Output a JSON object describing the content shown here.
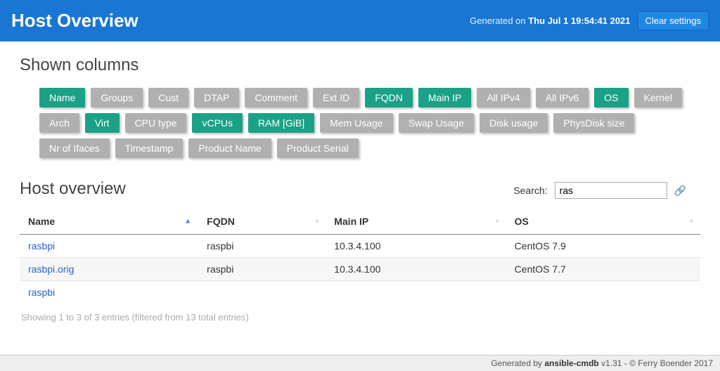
{
  "header": {
    "title": "Host Overview",
    "generated_prefix": "Generated on ",
    "generated_date": "Thu Jul 1 19:54:41 2021",
    "clear_label": "Clear settings"
  },
  "shown_columns": {
    "title": "Shown columns",
    "items": [
      {
        "label": "Name",
        "on": true
      },
      {
        "label": "Groups",
        "on": false
      },
      {
        "label": "Cust",
        "on": false
      },
      {
        "label": "DTAP",
        "on": false
      },
      {
        "label": "Comment",
        "on": false
      },
      {
        "label": "Ext ID",
        "on": false
      },
      {
        "label": "FQDN",
        "on": true
      },
      {
        "label": "Main IP",
        "on": true
      },
      {
        "label": "All IPv4",
        "on": false
      },
      {
        "label": "All IPv6",
        "on": false
      },
      {
        "label": "OS",
        "on": true
      },
      {
        "label": "Kernel",
        "on": false
      },
      {
        "label": "Arch",
        "on": false
      },
      {
        "label": "Virt",
        "on": true
      },
      {
        "label": "CPU type",
        "on": false
      },
      {
        "label": "vCPUs",
        "on": true
      },
      {
        "label": "RAM [GiB]",
        "on": true
      },
      {
        "label": "Mem Usage",
        "on": false
      },
      {
        "label": "Swap Usage",
        "on": false
      },
      {
        "label": "Disk usage",
        "on": false
      },
      {
        "label": "PhysDisk size",
        "on": false
      },
      {
        "label": "Nr of Ifaces",
        "on": false
      },
      {
        "label": "Timestamp",
        "on": false
      },
      {
        "label": "Product Name",
        "on": false
      },
      {
        "label": "Product Serial",
        "on": false
      }
    ]
  },
  "overview": {
    "title": "Host overview",
    "search_label": "Search:",
    "search_value": "ras",
    "headers": [
      "Name",
      "FQDN",
      "Main IP",
      "OS"
    ],
    "rows": [
      {
        "name": "rasbpi",
        "fqdn": "raspbi",
        "ip": "10.3.4.100",
        "os": "CentOS 7.9"
      },
      {
        "name": "rasbpi.orig",
        "fqdn": "raspbi",
        "ip": "10.3.4.100",
        "os": "CentOS 7.7"
      },
      {
        "name": "raspbi",
        "fqdn": "",
        "ip": "",
        "os": ""
      }
    ],
    "info": "Showing 1 to 3 of 3 entries (filtered from 13 total entries)"
  },
  "footer": {
    "prefix": "Generated by ",
    "name": "ansible-cmdb",
    "suffix": " v1.31 - © Ferry Boender 2017"
  }
}
